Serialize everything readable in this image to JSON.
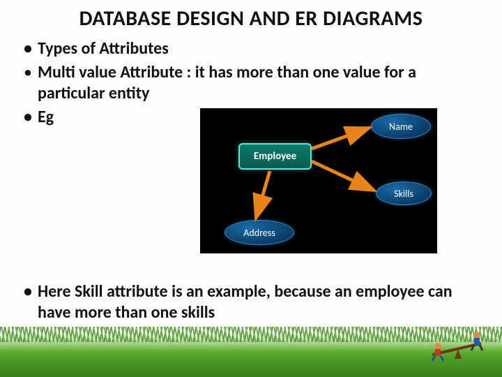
{
  "title": "DATABASE DESIGN AND ER DIAGRAMS",
  "bullets": {
    "b1": "Types of Attributes",
    "b2_lead": "Multi value Attribute",
    "b2_rest": " : it has more than one value for a particular entity",
    "b3": "Eg",
    "b4_pre": "Here ",
    "b4_hl": "Skill",
    "b4_post": " attribute is an example, because an employee can have more than one skills"
  },
  "diagram": {
    "entity": "Employee",
    "attrs": {
      "name": "Name",
      "skills": "Skills",
      "address": "Address"
    }
  }
}
